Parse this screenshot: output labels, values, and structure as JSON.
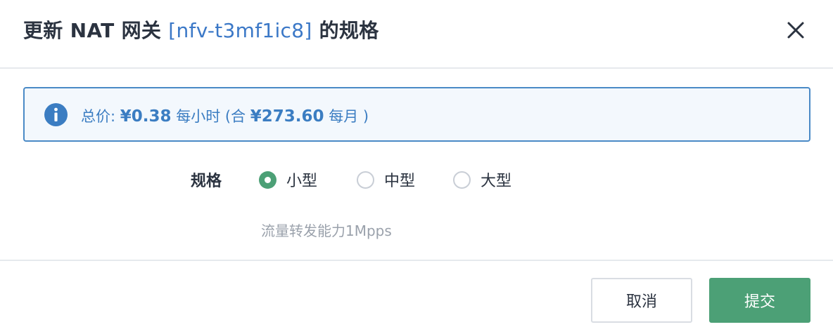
{
  "dialog": {
    "title_prefix": "更新 NAT 网关 ",
    "gateway_id": "[nfv-t3mf1ic8]",
    "title_suffix": " 的规格",
    "close_icon": "close-icon"
  },
  "price_info": {
    "icon": "info-icon",
    "label": "总价: ",
    "hourly_price": "¥0.38",
    "hourly_unit": " 每小时 (合 ",
    "monthly_price": "¥273.60",
    "monthly_unit": " 每月 )",
    "accent_color": "#3b7dc2"
  },
  "spec": {
    "label": "规格",
    "options": [
      {
        "label": "小型",
        "selected": true
      },
      {
        "label": "中型",
        "selected": false
      },
      {
        "label": "大型",
        "selected": false
      }
    ],
    "description": "流量转发能力1Mpps"
  },
  "footer": {
    "cancel_label": "取消",
    "submit_label": "提交",
    "submit_color": "#4ca076"
  }
}
